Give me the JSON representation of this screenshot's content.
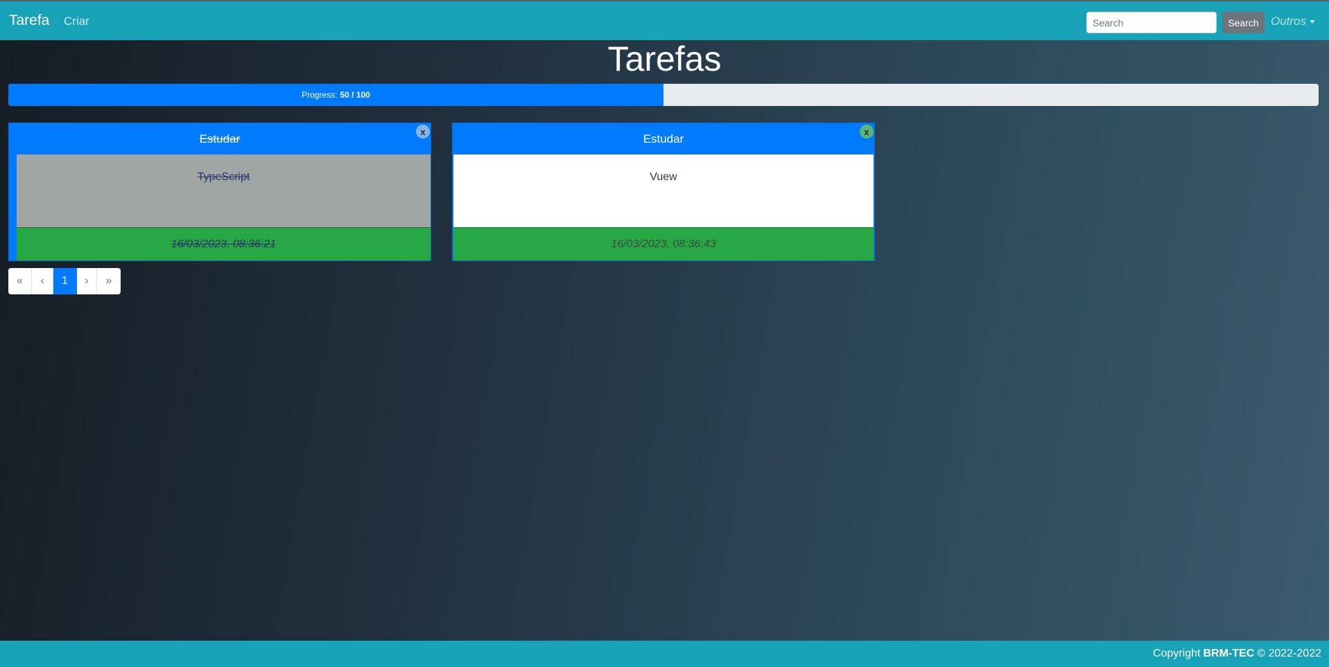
{
  "navbar": {
    "brand": "Tarefa",
    "create_link": "Criar",
    "search_placeholder": "Search",
    "search_button": "Search",
    "dropdown_label": "Outros"
  },
  "page": {
    "title": "Tarefas"
  },
  "progress": {
    "label": "Progress:",
    "value_text": "50 / 100",
    "value": 50,
    "max": 100
  },
  "tasks": [
    {
      "title": "Estudar",
      "description": "TypeScript",
      "timestamp": "16/03/2023, 08:36:21",
      "completed": true,
      "close_icon": "x"
    },
    {
      "title": "Estudar",
      "description": "Vuew",
      "timestamp": "16/03/2023, 08:36:43",
      "completed": false,
      "close_icon": "x"
    }
  ],
  "pagination": {
    "first": "«",
    "prev": "‹",
    "current": "1",
    "next": "›",
    "last": "»"
  },
  "footer": {
    "prefix": "Copyright",
    "company": "BRM-TEC",
    "suffix": "© 2022-2022"
  },
  "colors": {
    "navbar": "#17a2b8",
    "primary": "#007bff",
    "success": "#28a745",
    "secondary": "#6c757d"
  }
}
